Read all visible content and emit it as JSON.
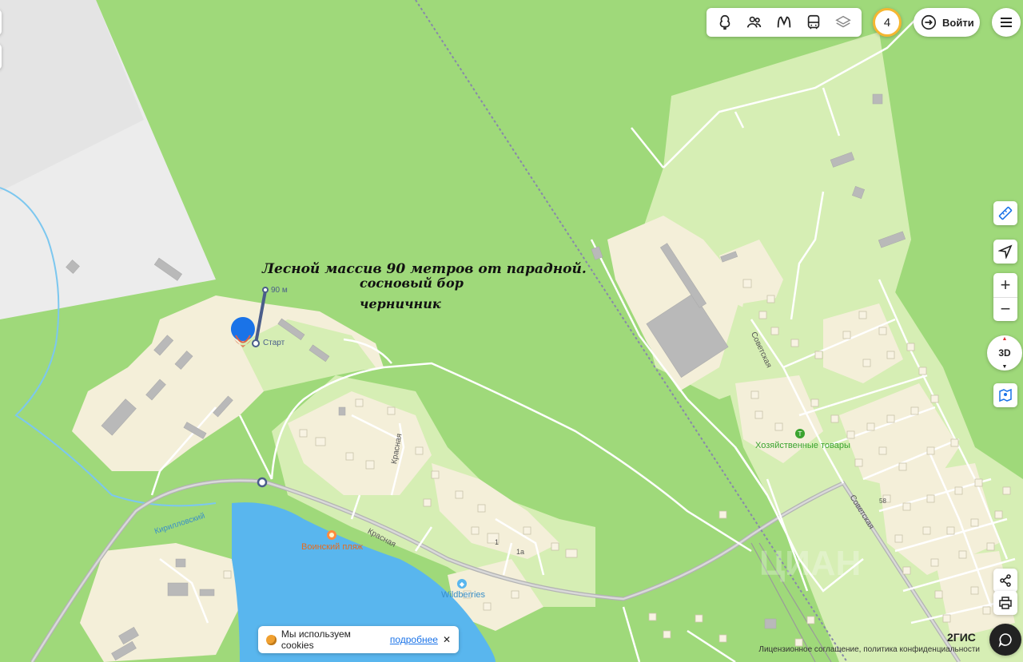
{
  "toolbar": {
    "icons": [
      "tree-icon",
      "people-icon",
      "metro-icon",
      "bus-icon",
      "layers-icon"
    ]
  },
  "notifications": {
    "count": "4"
  },
  "login": {
    "label": "Войти"
  },
  "annotation": {
    "line1": "Лесной массив  90 метров от парадной.",
    "line2": "сосновый бор",
    "line3": "черничник"
  },
  "route": {
    "distance": "90 м",
    "start": "Старт"
  },
  "streets": {
    "krasnaya_vertical": "Красная",
    "krasnaya_road": "Красная",
    "sovetskaya_upper": "Советская",
    "sovetskaya_lower": "Советская",
    "kirillovsky": "Кирилловский"
  },
  "pois": {
    "hardware": "Хозяйственные товары",
    "beach": "Воинский пляж",
    "wildberries": "Wildberries"
  },
  "house_numbers": {
    "n1": "1",
    "n1a": "1а",
    "n58": "58"
  },
  "controls": {
    "zoom_in": "+",
    "zoom_out": "−",
    "view_3d": "3D"
  },
  "cookie": {
    "text": "Мы используем cookies",
    "more": "подробнее",
    "close": "✕"
  },
  "footer": {
    "legal": "Лицензионное соглашение, политика конфиденциальности",
    "brand": "2ГИС"
  },
  "colors": {
    "forest": "#9fd97a",
    "settlement": "#d6eeb4",
    "building_area": "#f4efd9",
    "water": "#59b6ee",
    "route": "#4a5d8a",
    "pin": "#1a73e8"
  }
}
